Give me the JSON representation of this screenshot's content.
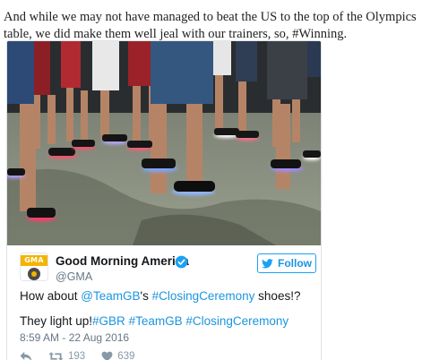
{
  "article": {
    "paragraph": "And while we may not have managed to beat the US to the top of the Olympics table, we did make them well jeal with our trainers, so, #Winning."
  },
  "tweet": {
    "photo_icon": "photo-of-light-up-shoes",
    "avatar_text": "GMA",
    "display_name": "Good Morning America",
    "handle": "@GMA",
    "verified_icon": "verified-badge-icon",
    "follow_label": "Follow",
    "accent_color": "#1da1f2",
    "text_line1": {
      "prefix": "How about ",
      "mention": "@TeamGB",
      "middle": "'s ",
      "hashtag": "#ClosingCeremony",
      "suffix": " shoes!?"
    },
    "text_line2": {
      "prefix": "They light up!",
      "hashtags": [
        "#GBR",
        "#TeamGB",
        "#ClosingCeremony"
      ]
    },
    "timestamp": "8:59 AM - 22 Aug 2016",
    "actions": {
      "reply_icon": "reply-icon",
      "retweet_icon": "retweet-icon",
      "retweet_count": "193",
      "like_icon": "heart-icon",
      "like_count": "639"
    }
  }
}
